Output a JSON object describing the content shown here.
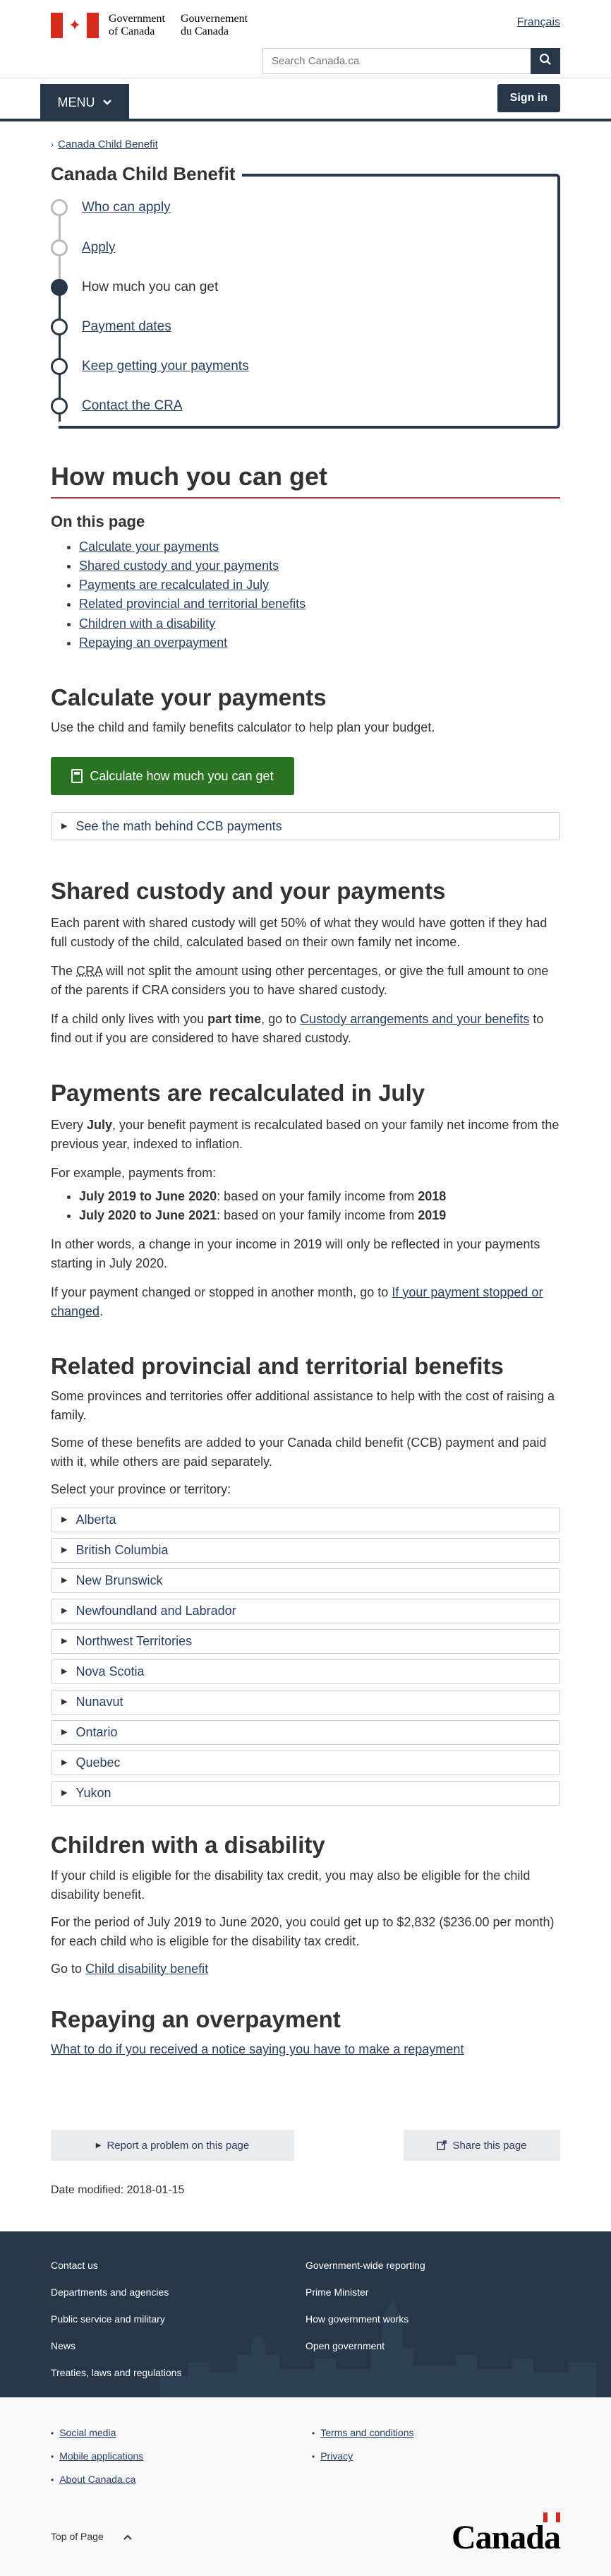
{
  "header": {
    "gov_en": [
      "Government",
      "of Canada"
    ],
    "gov_fr": [
      "Gouvernement",
      "du Canada"
    ],
    "lang_link": "Français",
    "search_placeholder": "Search Canada.ca",
    "menu_label": "MENU",
    "signin_label": "Sign in"
  },
  "breadcrumb": {
    "items": [
      "Canada Child Benefit"
    ]
  },
  "steps": {
    "title": "Canada Child Benefit",
    "items": [
      {
        "label": "Who can apply",
        "state": "visited"
      },
      {
        "label": "Apply",
        "state": "visited"
      },
      {
        "label": "How much you can get",
        "state": "current"
      },
      {
        "label": "Payment dates",
        "state": "next"
      },
      {
        "label": "Keep getting your payments",
        "state": "next"
      },
      {
        "label": "Contact the CRA",
        "state": "next"
      }
    ]
  },
  "page": {
    "title": "How much you can get",
    "on_this_page": "On this page",
    "toc": [
      "Calculate your payments",
      "Shared custody and your payments",
      "Payments are recalculated in July",
      "Related provincial and territorial benefits",
      "Children with a disability",
      "Repaying an overpayment"
    ]
  },
  "calculate": {
    "heading": "Calculate your payments",
    "intro": "Use the child and family benefits calculator to help plan your budget.",
    "button": "Calculate how much you can get",
    "details": "See the math behind CCB payments"
  },
  "shared": {
    "heading": "Shared custody and your payments",
    "p1": "Each parent with shared custody will get 50% of what they would have gotten if they had full custody of the child, calculated based on their own family net income.",
    "p2_a": "The ",
    "p2_abbr": "CRA",
    "p2_b": " will not split the amount using other percentages, or give the full amount to one of the parents if CRA considers you to have shared custody.",
    "p3_a": "If a child only lives with you ",
    "p3_bold": "part time",
    "p3_b": ", go to ",
    "p3_link": "Custody arrangements and your benefits",
    "p3_c": " to find out if you are considered to have shared custody."
  },
  "recalc": {
    "heading": "Payments are recalculated in July",
    "p1_a": "Every ",
    "p1_bold": "July",
    "p1_b": ", your benefit payment is recalculated based on your family net income from the previous year, indexed to inflation.",
    "p2": "For example, payments from:",
    "bullets": [
      {
        "bold": "July 2019 to June 2020",
        "text": ": based on your family income from ",
        "year": "2018"
      },
      {
        "bold": "July 2020 to June 2021",
        "text": ": based on your family income from ",
        "year": "2019"
      }
    ],
    "p3": "In other words, a change in your income in 2019 will only be reflected in your payments starting in July 2020.",
    "p4_a": "If your payment changed or stopped in another month, go to ",
    "p4_link": "If your payment stopped or changed",
    "p4_b": "."
  },
  "provincial": {
    "heading": "Related provincial and territorial benefits",
    "p1": "Some provinces and territories offer additional assistance to help with the cost of raising a family.",
    "p2": "Some of these benefits are added to your Canada child benefit (CCB) payment and paid with it, while others are paid separately.",
    "p3": "Select your province or territory:",
    "provinces": [
      "Alberta",
      "British Columbia",
      "New Brunswick",
      "Newfoundland and Labrador",
      "Northwest Territories",
      "Nova Scotia",
      "Nunavut",
      "Ontario",
      "Quebec",
      "Yukon"
    ]
  },
  "disability": {
    "heading": "Children with a disability",
    "p1": "If your child is eligible for the disability tax credit, you may also be eligible for the child disability benefit.",
    "p2": "For the period of July 2019 to June 2020, you could get up to $2,832 ($236.00 per month) for each child who is eligible for the disability tax credit.",
    "p3_a": "Go to ",
    "p3_link": "Child disability benefit"
  },
  "overpayment": {
    "heading": "Repaying an overpayment",
    "link": "What to do if you received a notice saying you have to make a repayment"
  },
  "feedback": {
    "report": "Report a problem on this page",
    "share": "Share this page"
  },
  "date_modified": "Date modified: 2018-01-15",
  "footer": {
    "col1": [
      "Contact us",
      "Departments and agencies",
      "Public service and military",
      "News",
      "Treaties, laws and regulations"
    ],
    "col2": [
      "Government-wide reporting",
      "Prime Minister",
      "How government works",
      "Open government"
    ],
    "sub_col1": [
      "Social media",
      "Mobile applications",
      "About Canada.ca"
    ],
    "sub_col2": [
      "Terms and conditions",
      "Privacy"
    ],
    "top_of_page": "Top of Page",
    "wordmark": "Canada"
  },
  "colors": {
    "primary": "#26374a",
    "link": "#284162",
    "button_green": "#2a7322",
    "accent_red": "#af3c43",
    "flag_red": "#d52b1e"
  }
}
